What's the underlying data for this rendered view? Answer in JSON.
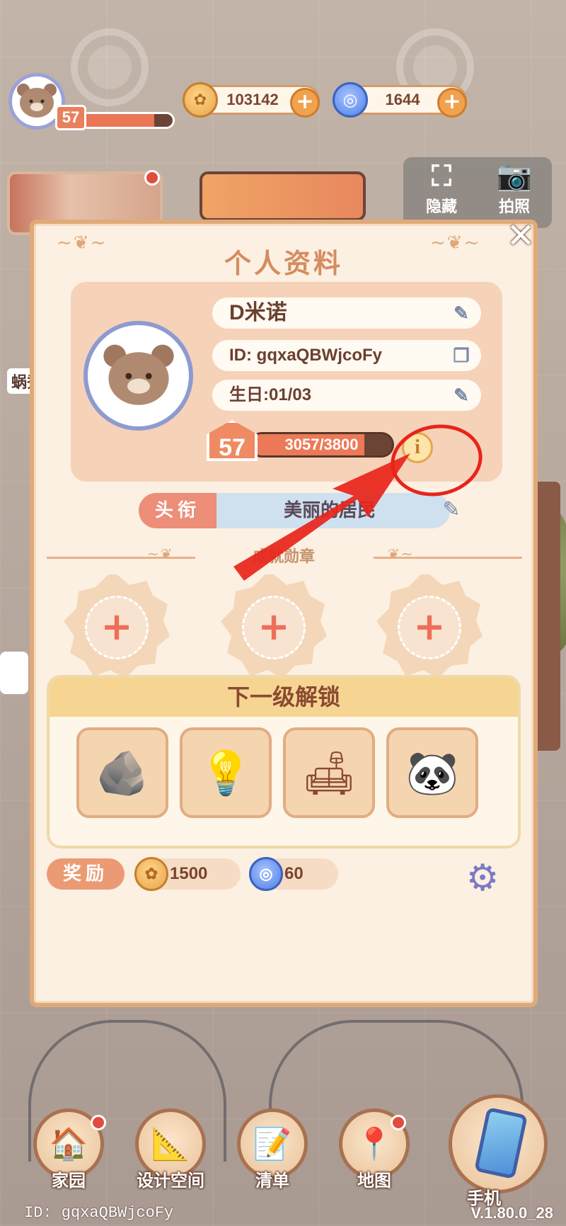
{
  "hud": {
    "player_level": "57",
    "xp_fraction": 0.8,
    "coins": "103142",
    "gems": "1644",
    "plus_glyph": "+"
  },
  "tools": {
    "hide_label": "隐藏",
    "photo_label": "拍照"
  },
  "side": {
    "label": "蜗秀"
  },
  "profile": {
    "title": "个人资料",
    "name": "D米诺",
    "id_text": "ID: gqxaQBWjcoFy",
    "birthday_text": "生日:01/03",
    "level": "57",
    "xp_text": "3057/3800",
    "xp_fraction": 0.8045,
    "info_glyph": "i",
    "title_label": "头衔",
    "title_value": "美丽的居民",
    "achievements_label": "成就勋章",
    "medal_glyph": "+",
    "unlock_title": "下一级解锁",
    "reward_label": "奖励",
    "reward_coins": "1500",
    "reward_gems": "60",
    "close_glyph": "✕"
  },
  "unlock_items": [
    {
      "icon": "lamp-rock-icon",
      "glyph": "🪨"
    },
    {
      "icon": "floor-lamp-icon",
      "glyph": "💡"
    },
    {
      "icon": "glass-table-icon",
      "glyph": "🛋"
    },
    {
      "icon": "panda-plush-icon",
      "glyph": "🐼"
    }
  ],
  "bottom_nav": {
    "home": "家园",
    "design": "设计空间",
    "list": "清单",
    "map": "地图",
    "phone": "手机"
  },
  "footer": {
    "id": "ID: gqxaQBWjcoFy",
    "version": "V.1.80.0_28"
  },
  "colors": {
    "accent": "#e8805e",
    "panel": "#fbf0e2",
    "annotation_red": "#e8241a"
  }
}
